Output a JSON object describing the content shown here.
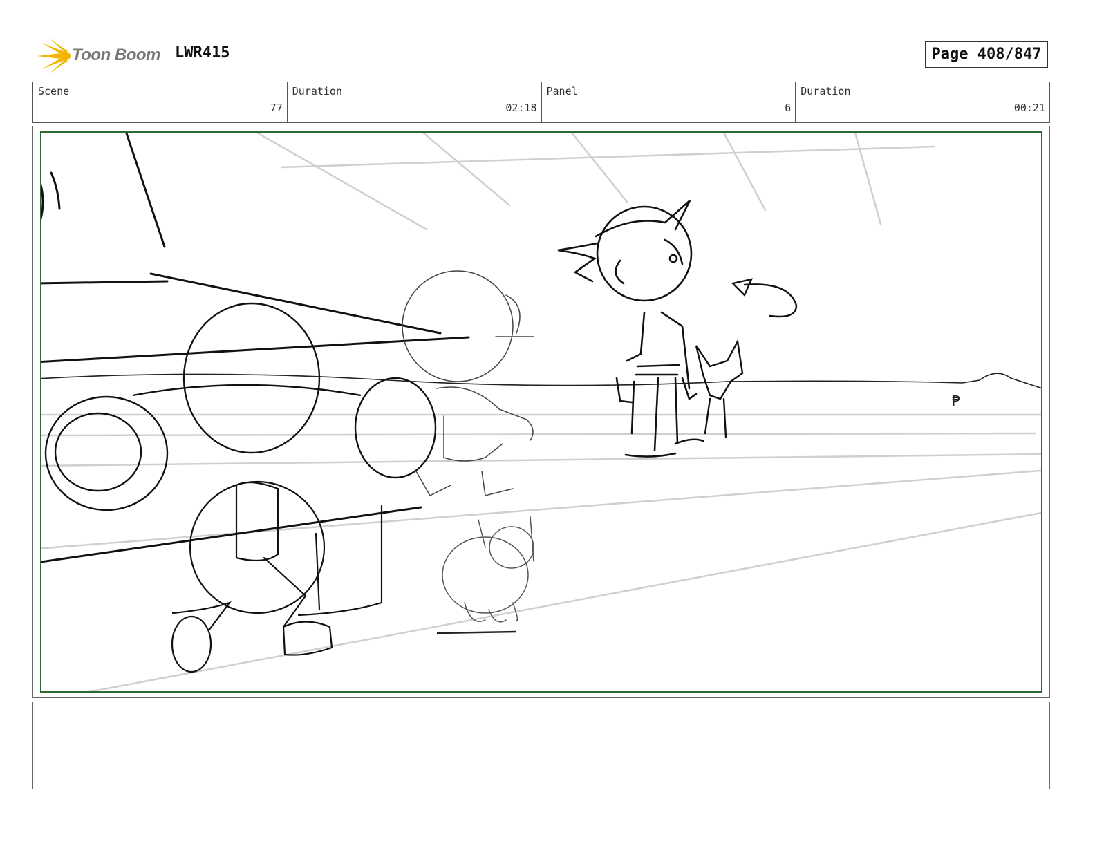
{
  "header": {
    "logo_text": "Toon Boom",
    "project": "LWR415",
    "page": "Page 408/847"
  },
  "info": {
    "scene_label": "Scene",
    "scene_value": "77",
    "scene_duration_label": "Duration",
    "scene_duration_value": "02:18",
    "panel_label": "Panel",
    "panel_value": "6",
    "panel_duration_label": "Duration",
    "panel_duration_value": "00:21"
  },
  "colors": {
    "logo_accent": "#f2b705",
    "panel_border": "#2d6b2d",
    "sketch_line": "#111111",
    "guide_line": "#c8c8c8"
  },
  "notes": {
    "text": ""
  }
}
